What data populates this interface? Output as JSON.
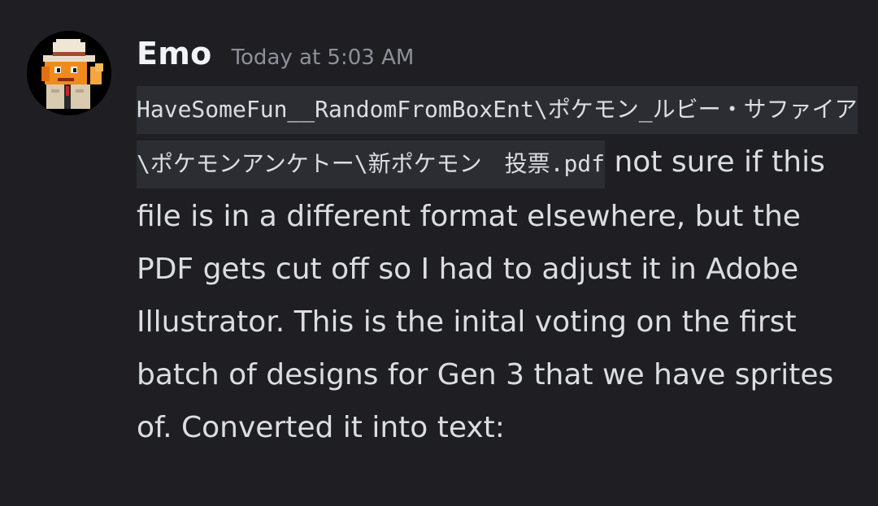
{
  "message": {
    "username": "Emo",
    "timestamp": "Today at 5:03 AM",
    "avatar_icon": "pixel-detective-fish-avatar",
    "code_path": "HaveSomeFun__RandomFromBoxEnt\\ポケモン_ルビー・サファイア\\ポケモンアンケトー\\新ポケモン　投票.pdf",
    "text": " not sure if this file is in a different format elsewhere, but the PDF gets cut off so I had to adjust it in Adobe Illustrator. This is the inital voting on the first batch of designs for Gen 3 that we have sprites of. Converted it into text:"
  },
  "colors": {
    "background": "#1f1f23",
    "username": "#f2f3f5",
    "timestamp": "#8e9099",
    "text": "#dbdee1",
    "code_background": "#2b2d33"
  }
}
